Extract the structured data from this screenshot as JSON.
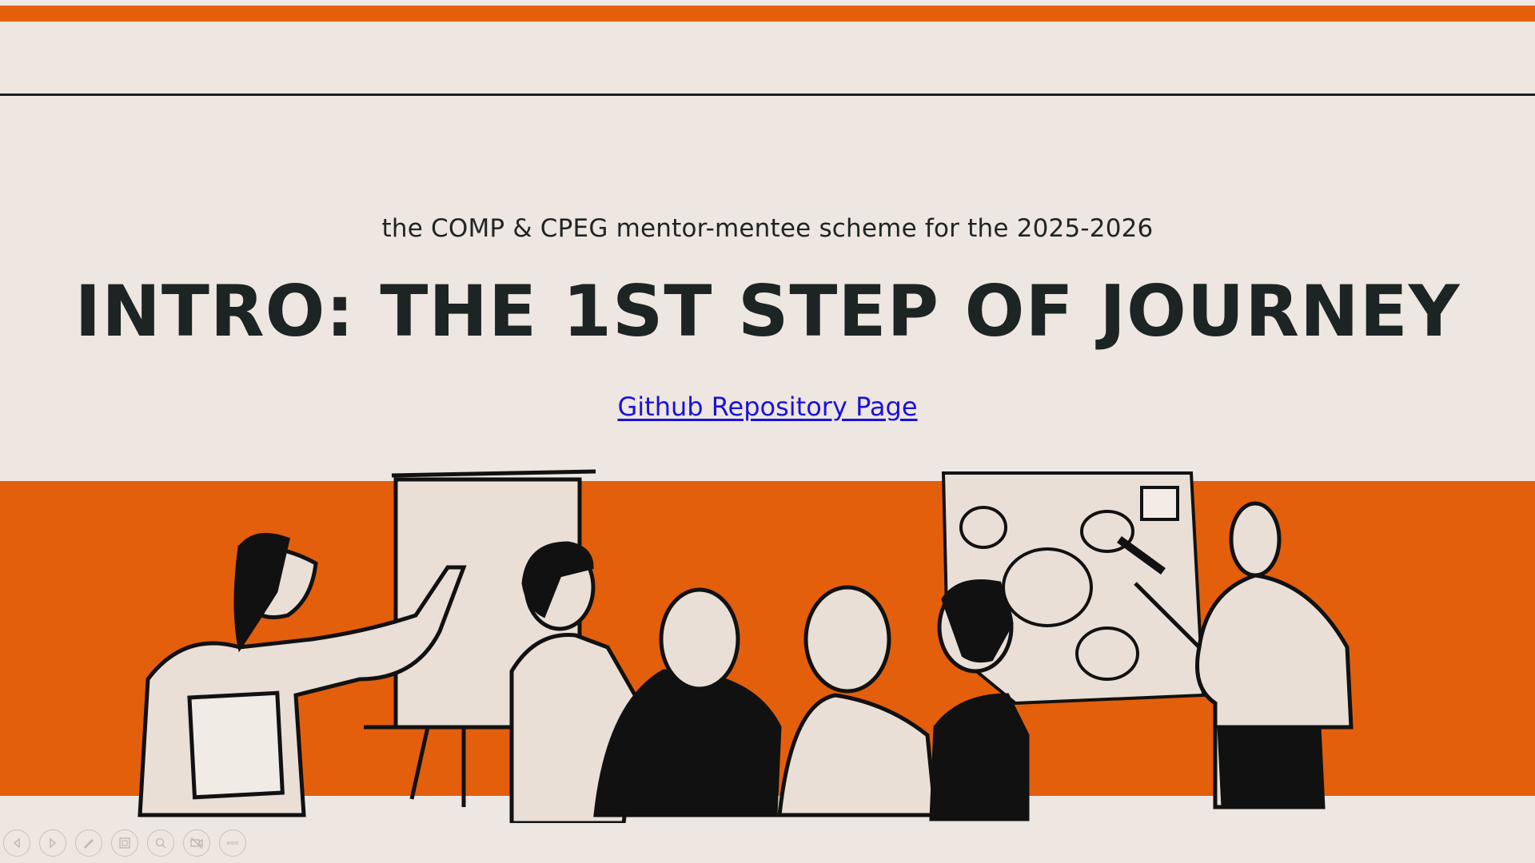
{
  "slide": {
    "subtitle": "the COMP & CPEG mentor-mentee scheme for the 2025-2026",
    "title": "INTRO: THE 1ST STEP OF JOURNEY",
    "link_text": "Github Repository Page"
  },
  "colors": {
    "background": "#eee6e0",
    "accent_orange": "#e35f0c",
    "title_text": "#1c2424",
    "link": "#1a12d8"
  },
  "illustration": {
    "description_icon": "team-meeting-illustration"
  },
  "controls": [
    {
      "name": "previous-slide-button",
      "icon": "arrow-left-icon"
    },
    {
      "name": "next-slide-button",
      "icon": "arrow-right-icon"
    },
    {
      "name": "pen-tool-button",
      "icon": "pen-icon"
    },
    {
      "name": "slide-sorter-button",
      "icon": "slides-grid-icon"
    },
    {
      "name": "zoom-button",
      "icon": "magnifier-icon"
    },
    {
      "name": "camera-off-button",
      "icon": "camera-off-icon"
    },
    {
      "name": "more-options-button",
      "icon": "ellipsis-icon"
    }
  ]
}
